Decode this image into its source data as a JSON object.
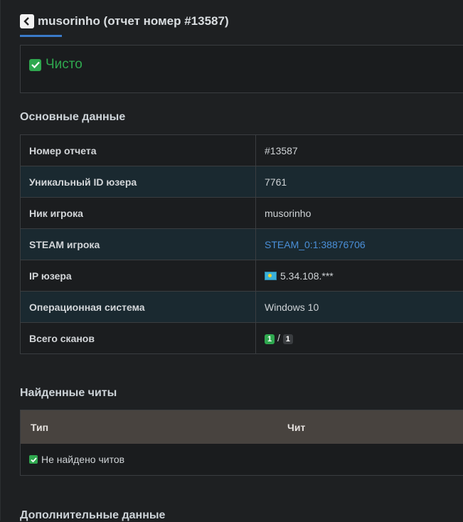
{
  "header": {
    "title": "musorinho (отчет номер #13587)"
  },
  "status": {
    "label": "Чисто",
    "color": "#2fa84f"
  },
  "main_section": {
    "title": "Основные данные",
    "rows": [
      {
        "key": "Номер отчета",
        "value": "#13587"
      },
      {
        "key": "Уникальный ID юзера",
        "value": "7761"
      },
      {
        "key": "Ник игрока",
        "value": "musorinho"
      },
      {
        "key": "STEAM игрока",
        "value": "STEAM_0:1:38876706"
      },
      {
        "key": "IP юзера",
        "value": "5.34.108.***",
        "icon": "kazakhstan-flag-icon"
      },
      {
        "key": "Операционная система",
        "value": "Windows 10"
      },
      {
        "key": "Всего сканов",
        "value_a": "1",
        "separator": "/",
        "value_b": "1"
      }
    ]
  },
  "cheats_section": {
    "title": "Найденные читы",
    "columns": [
      "Тип",
      "Чит"
    ],
    "empty_text": "Не найдено читов"
  },
  "extra_section": {
    "title": "Дополнительные данные"
  },
  "colors": {
    "accent": "#3a7ac8",
    "link": "#4a8fd8",
    "success": "#2fa84f",
    "table_head": "#48433f"
  }
}
